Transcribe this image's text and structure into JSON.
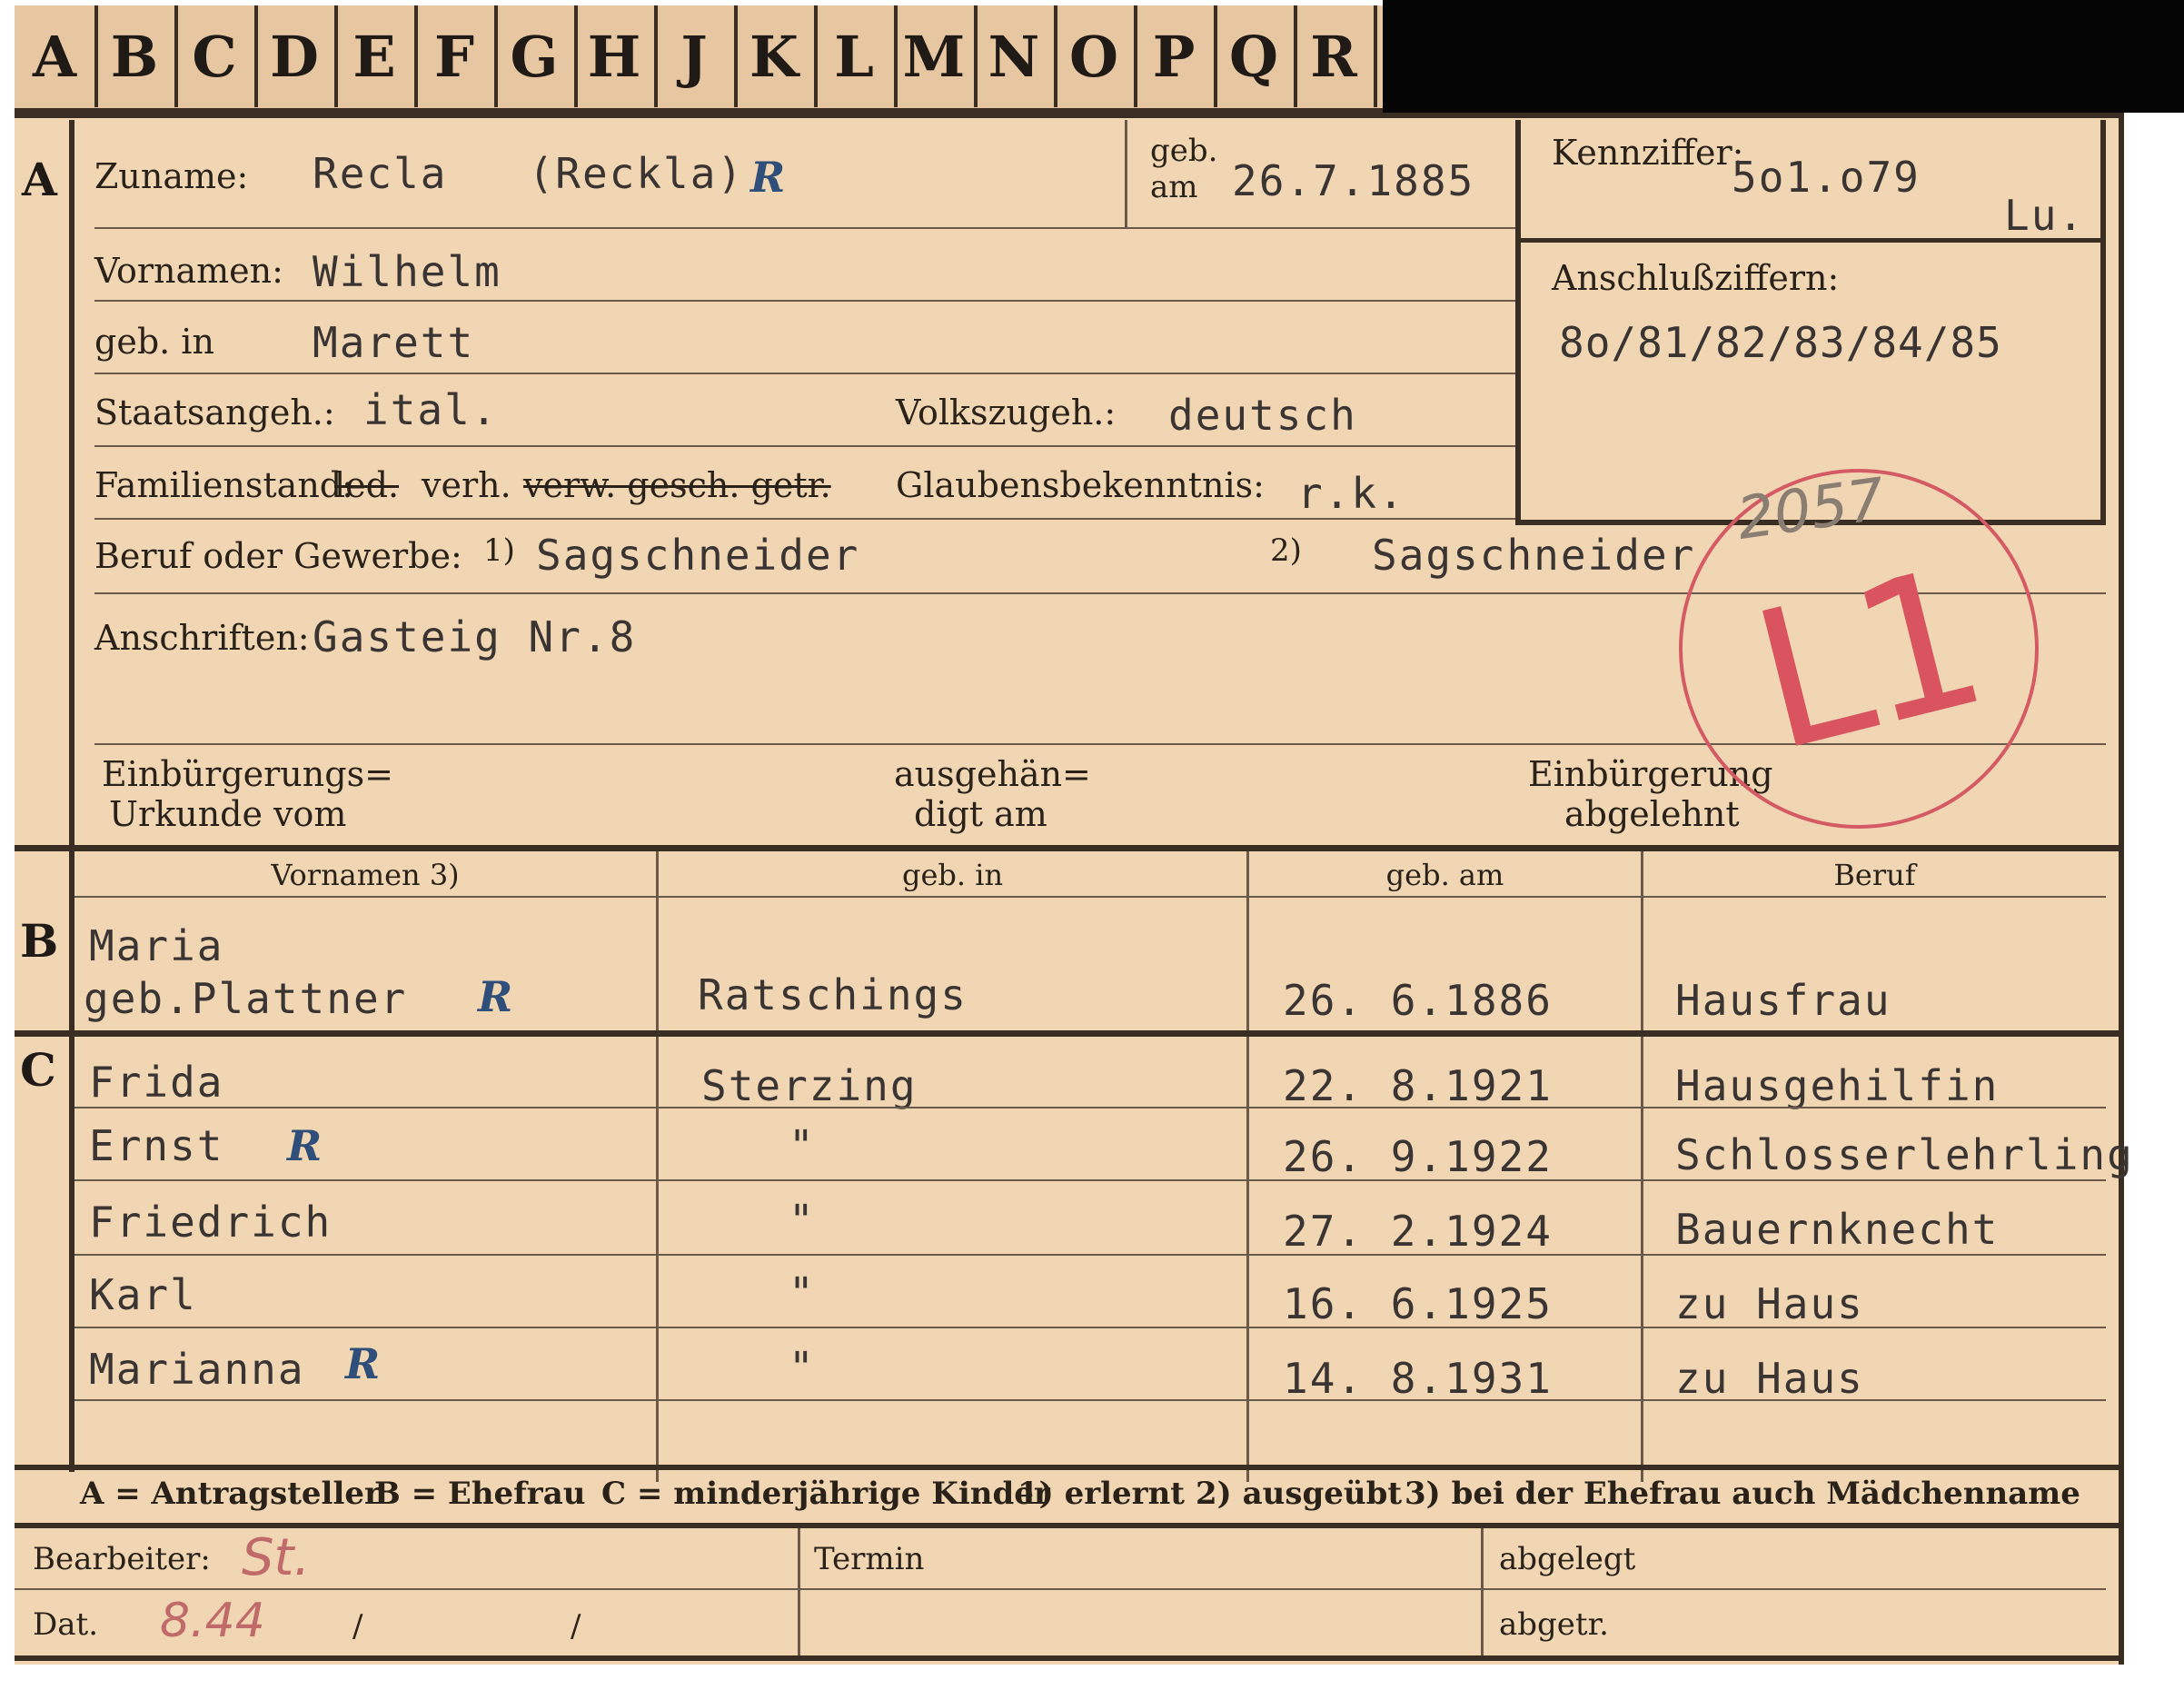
{
  "tabs": [
    "A",
    "B",
    "C",
    "D",
    "E",
    "F",
    "G",
    "H",
    "J",
    "K",
    "L",
    "M",
    "N",
    "O",
    "P",
    "Q",
    "R"
  ],
  "section_a": {
    "marker": "A",
    "zuname_label": "Zuname:",
    "zuname": "Recla   (Reckla)",
    "r_mark": "R",
    "geb_am_label_1": "geb.",
    "geb_am_label_2": "am",
    "geb_am": "26.7.1885",
    "vornamen_label": "Vornamen:",
    "vornamen": "Wilhelm",
    "geb_in_label": "geb. in",
    "geb_in": "Marett",
    "staatsangeh_label": "Staatsangeh.:",
    "staatsangeh": "ital.",
    "volkszugeh_label": "Volkszugeh.:",
    "volkszugeh": "deutsch",
    "familienstand_label": "Familienstand:",
    "fam_led": "led.",
    "fam_verh": "verh.",
    "fam_rest": "verw. gesch. getr.",
    "glaubens_label": "Glaubensbekenntnis:",
    "glaubens": "r.k.",
    "beruf_label": "Beruf oder Gewerbe:",
    "beruf_note1": "1)",
    "beruf1": "Sagschneider",
    "beruf_note2": "2)",
    "beruf2": "Sagschneider",
    "anschriften_label": "Anschriften:",
    "anschriften": "Gasteig Nr.8",
    "einb_urkunde_1": "Einbürgerungs=",
    "einb_urkunde_2": "Urkunde vom",
    "ausgehaendigt_1": "ausgehän=",
    "ausgehaendigt_2": "digt am",
    "einb_abgelehnt_1": "Einbürgerung",
    "einb_abgelehnt_2": "abgelehnt"
  },
  "kennziffer": {
    "label": "Kennziffer:",
    "value": "5o1.o79",
    "suffix": "Lu.",
    "anschluss_label": "Anschlußziffern:",
    "anschluss_value": "8o/81/82/83/84/85"
  },
  "stamp": {
    "text": "L1",
    "number": "2057"
  },
  "section_b": {
    "marker": "B",
    "headers": [
      "Vornamen 3)",
      "geb. in",
      "geb. am",
      "Beruf"
    ],
    "name_line1": "Maria",
    "name_line2": "geb.Plattner",
    "r_mark": "R",
    "geb_in": "Ratschings",
    "geb_am": "26. 6.1886",
    "beruf": "Hausfrau"
  },
  "section_c": {
    "marker": "C",
    "rows": [
      {
        "name": "Frida",
        "geb_in": "Sterzing",
        "geb_am": "22. 8.1921",
        "beruf": "Hausgehilfin",
        "mark": ""
      },
      {
        "name": "Ernst",
        "geb_in": "\"",
        "geb_am": "26. 9.1922",
        "beruf": "Schlosserlehrling",
        "mark": "R"
      },
      {
        "name": "Friedrich",
        "geb_in": "\"",
        "geb_am": "27. 2.1924",
        "beruf": "Bauernknecht",
        "mark": ""
      },
      {
        "name": "Karl",
        "geb_in": "\"",
        "geb_am": "16. 6.1925",
        "beruf": "zu Haus",
        "mark": ""
      },
      {
        "name": "Marianna",
        "geb_in": "\"",
        "geb_am": "14. 8.1931",
        "beruf": "zu Haus",
        "mark": "R"
      }
    ]
  },
  "legend": {
    "a": "A = Antragsteller",
    "b": "B = Ehefrau",
    "c": "C = minderjährige Kinder",
    "n1": "1) erlernt",
    "n2": "2) ausgeübt",
    "n3": "3) bei der Ehefrau auch Mädchenname"
  },
  "footer": {
    "bearbeiter_label": "Bearbeiter:",
    "bearbeiter_sig": "St.",
    "dat_label": "Dat.",
    "dat_value": "8.44",
    "slash1": "/",
    "slash2": "/",
    "termin_label": "Termin",
    "abgelegt_label": "abgelegt",
    "abgetr_label": "abgetr."
  }
}
